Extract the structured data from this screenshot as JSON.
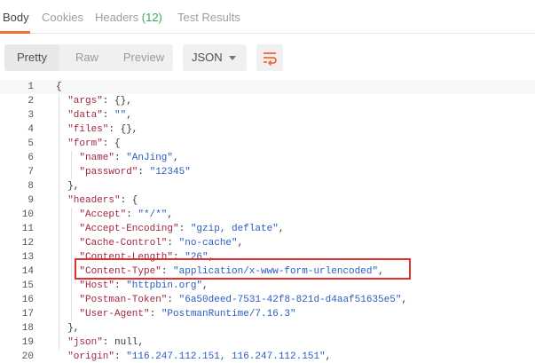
{
  "tabs": [
    {
      "label": "Body",
      "active": true
    },
    {
      "label": "Cookies",
      "active": false
    },
    {
      "label": "Headers",
      "count": "(12)",
      "active": false
    },
    {
      "label": "Test Results",
      "active": false
    }
  ],
  "toolbar": {
    "view_modes": [
      "Pretty",
      "Raw",
      "Preview"
    ],
    "active_view": "Pretty",
    "format": "JSON",
    "wrap_icon": "wrap-lines-icon",
    "accent_color": "#f26b3a"
  },
  "code": {
    "lines": [
      {
        "num": "1",
        "tokens": [
          {
            "t": "p",
            "v": "{"
          }
        ]
      },
      {
        "num": "2",
        "tokens": [
          {
            "t": "k",
            "v": "\"args\""
          },
          {
            "t": "p",
            "v": ": {},"
          }
        ]
      },
      {
        "num": "3",
        "tokens": [
          {
            "t": "k",
            "v": "\"data\""
          },
          {
            "t": "p",
            "v": ": "
          },
          {
            "t": "s",
            "v": "\"\""
          },
          {
            "t": "p",
            "v": ","
          }
        ]
      },
      {
        "num": "4",
        "tokens": [
          {
            "t": "k",
            "v": "\"files\""
          },
          {
            "t": "p",
            "v": ": {},"
          }
        ]
      },
      {
        "num": "5",
        "tokens": [
          {
            "t": "k",
            "v": "\"form\""
          },
          {
            "t": "p",
            "v": ": {"
          }
        ]
      },
      {
        "num": "6",
        "tokens": [
          {
            "t": "k",
            "v": "\"name\""
          },
          {
            "t": "p",
            "v": ": "
          },
          {
            "t": "s",
            "v": "\"AnJing\""
          },
          {
            "t": "p",
            "v": ","
          }
        ]
      },
      {
        "num": "7",
        "tokens": [
          {
            "t": "k",
            "v": "\"password\""
          },
          {
            "t": "p",
            "v": ": "
          },
          {
            "t": "s",
            "v": "\"12345\""
          }
        ]
      },
      {
        "num": "8",
        "tokens": [
          {
            "t": "p",
            "v": "},"
          }
        ]
      },
      {
        "num": "9",
        "tokens": [
          {
            "t": "k",
            "v": "\"headers\""
          },
          {
            "t": "p",
            "v": ": {"
          }
        ]
      },
      {
        "num": "10",
        "tokens": [
          {
            "t": "k",
            "v": "\"Accept\""
          },
          {
            "t": "p",
            "v": ": "
          },
          {
            "t": "s",
            "v": "\"*/*\""
          },
          {
            "t": "p",
            "v": ","
          }
        ]
      },
      {
        "num": "11",
        "tokens": [
          {
            "t": "k",
            "v": "\"Accept-Encoding\""
          },
          {
            "t": "p",
            "v": ": "
          },
          {
            "t": "s",
            "v": "\"gzip, deflate\""
          },
          {
            "t": "p",
            "v": ","
          }
        ]
      },
      {
        "num": "12",
        "tokens": [
          {
            "t": "k",
            "v": "\"Cache-Control\""
          },
          {
            "t": "p",
            "v": ": "
          },
          {
            "t": "s",
            "v": "\"no-cache\""
          },
          {
            "t": "p",
            "v": ","
          }
        ]
      },
      {
        "num": "13",
        "tokens": [
          {
            "t": "k",
            "v": "\"Content-Length\""
          },
          {
            "t": "p",
            "v": ": "
          },
          {
            "t": "s",
            "v": "\"26\""
          },
          {
            "t": "p",
            "v": ","
          }
        ]
      },
      {
        "num": "14",
        "tokens": [
          {
            "t": "k",
            "v": "\"Content-Type\""
          },
          {
            "t": "p",
            "v": ": "
          },
          {
            "t": "s",
            "v": "\"application/x-www-form-urlencoded\""
          },
          {
            "t": "p",
            "v": ","
          }
        ]
      },
      {
        "num": "15",
        "tokens": [
          {
            "t": "k",
            "v": "\"Host\""
          },
          {
            "t": "p",
            "v": ": "
          },
          {
            "t": "s",
            "v": "\"httpbin.org\""
          },
          {
            "t": "p",
            "v": ","
          }
        ]
      },
      {
        "num": "16",
        "tokens": [
          {
            "t": "k",
            "v": "\"Postman-Token\""
          },
          {
            "t": "p",
            "v": ": "
          },
          {
            "t": "s",
            "v": "\"6a50deed-7531-42f8-821d-d4aaf51635e5\""
          },
          {
            "t": "p",
            "v": ","
          }
        ]
      },
      {
        "num": "17",
        "tokens": [
          {
            "t": "k",
            "v": "\"User-Agent\""
          },
          {
            "t": "p",
            "v": ": "
          },
          {
            "t": "s",
            "v": "\"PostmanRuntime/7.16.3\""
          }
        ]
      },
      {
        "num": "18",
        "tokens": [
          {
            "t": "p",
            "v": "},"
          }
        ]
      },
      {
        "num": "19",
        "tokens": [
          {
            "t": "k",
            "v": "\"json\""
          },
          {
            "t": "p",
            "v": ": null,"
          }
        ]
      },
      {
        "num": "20",
        "tokens": [
          {
            "t": "k",
            "v": "\"origin\""
          },
          {
            "t": "p",
            "v": ": "
          },
          {
            "t": "s",
            "v": "\"116.247.112.151, 116.247.112.151\""
          },
          {
            "t": "p",
            "v": ","
          }
        ]
      }
    ]
  },
  "highlight_color": "#e03030"
}
